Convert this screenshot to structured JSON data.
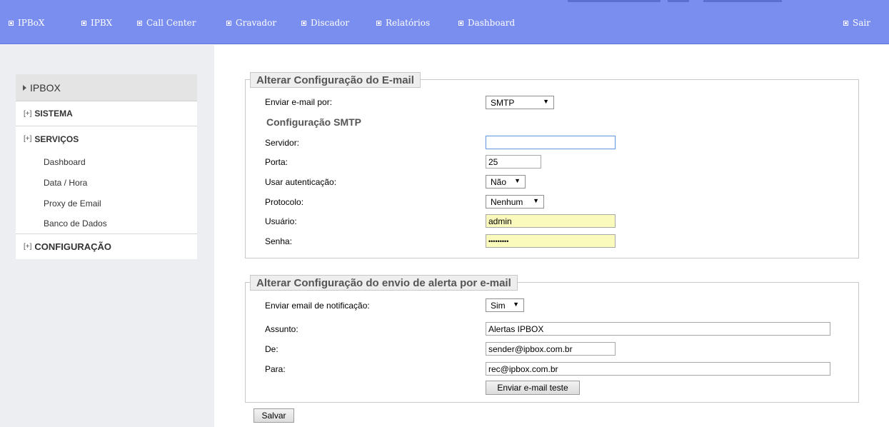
{
  "nav": {
    "items": [
      {
        "label": "IPBoX"
      },
      {
        "label": "IPBX"
      },
      {
        "label": "Call Center"
      },
      {
        "label": "Gravador"
      },
      {
        "label": "Discador"
      },
      {
        "label": "Relatórios"
      },
      {
        "label": "Dashboard"
      }
    ],
    "logout": "Sair",
    "bar_color": "#7a8ef0"
  },
  "sidebar": {
    "header": "IPBOX",
    "expander": "[+]",
    "sections": {
      "sistema": "SISTEMA",
      "servicos": "SERVIÇOS",
      "configuracao": "CONFIGURAÇÃO"
    },
    "servicos_items": [
      "Dashboard",
      "Data / Hora",
      "Proxy de Email",
      "Banco de Dados"
    ]
  },
  "email_config": {
    "legend": "Alterar Configuração do E-mail",
    "send_via_label": "Enviar e-mail por:",
    "send_via_value": "SMTP",
    "smtp_heading": "Configuração SMTP",
    "server_label": "Servidor:",
    "server_value": "",
    "port_label": "Porta:",
    "port_value": "25",
    "auth_label": "Usar autenticação:",
    "auth_value": "Não",
    "protocol_label": "Protocolo:",
    "protocol_value": "Nenhum",
    "user_label": "Usuário:",
    "user_value": "admin",
    "password_label": "Senha:",
    "password_value": "•••••••••"
  },
  "alert_config": {
    "legend": "Alterar Configuração do envio de alerta por e-mail",
    "notify_label": "Enviar email de notificação:",
    "notify_value": "Sim",
    "subject_label": "Assunto:",
    "subject_value": "Alertas IPBOX",
    "from_label": "De:",
    "from_value": "sender@ipbox.com.br",
    "to_label": "Para:",
    "to_value": "rec@ipbox.com.br",
    "test_button": "Enviar e-mail teste"
  },
  "save_button": "Salvar"
}
